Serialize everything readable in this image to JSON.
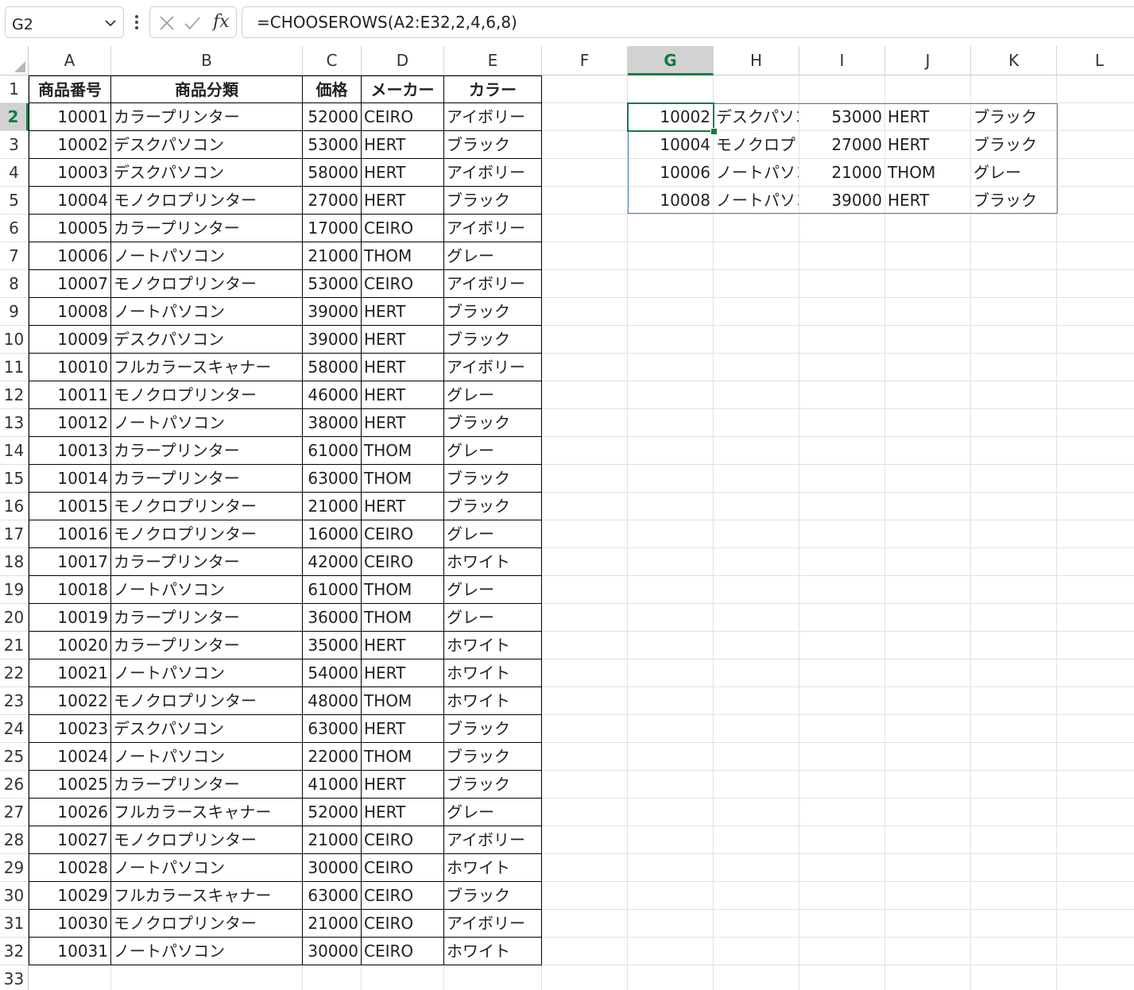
{
  "name_box": {
    "value": "G2"
  },
  "formula_bar": {
    "cancel_icon": "close-icon",
    "enter_icon": "check-icon",
    "function_label": "fx",
    "formula": "=CHOOSEROWS(A2:E32,2,4,6,8)"
  },
  "selected_cell": "G2",
  "columns": [
    "A",
    "B",
    "C",
    "D",
    "E",
    "F",
    "G",
    "H",
    "I",
    "J",
    "K",
    "L"
  ],
  "rows": [
    "1",
    "2",
    "3",
    "4",
    "5",
    "6",
    "7",
    "8",
    "9",
    "10",
    "11",
    "12",
    "13",
    "14",
    "15",
    "16",
    "17",
    "18",
    "19",
    "20",
    "21",
    "22",
    "23",
    "24",
    "25",
    "26",
    "27",
    "28",
    "29",
    "30",
    "31",
    "32",
    "33"
  ],
  "table": {
    "headers": [
      "商品番号",
      "商品分類",
      "価格",
      "メーカー",
      "カラー"
    ],
    "rows": [
      [
        "10001",
        "カラープリンター",
        "52000",
        "CEIRO",
        "アイボリー"
      ],
      [
        "10002",
        "デスクパソコン",
        "53000",
        "HERT",
        "ブラック"
      ],
      [
        "10003",
        "デスクパソコン",
        "58000",
        "HERT",
        "アイボリー"
      ],
      [
        "10004",
        "モノクロプリンター",
        "27000",
        "HERT",
        "ブラック"
      ],
      [
        "10005",
        "カラープリンター",
        "17000",
        "CEIRO",
        "アイボリー"
      ],
      [
        "10006",
        "ノートパソコン",
        "21000",
        "THOM",
        "グレー"
      ],
      [
        "10007",
        "モノクロプリンター",
        "53000",
        "CEIRO",
        "アイボリー"
      ],
      [
        "10008",
        "ノートパソコン",
        "39000",
        "HERT",
        "ブラック"
      ],
      [
        "10009",
        "デスクパソコン",
        "39000",
        "HERT",
        "ブラック"
      ],
      [
        "10010",
        "フルカラースキャナー",
        "58000",
        "HERT",
        "アイボリー"
      ],
      [
        "10011",
        "モノクロプリンター",
        "46000",
        "HERT",
        "グレー"
      ],
      [
        "10012",
        "ノートパソコン",
        "38000",
        "HERT",
        "ブラック"
      ],
      [
        "10013",
        "カラープリンター",
        "61000",
        "THOM",
        "グレー"
      ],
      [
        "10014",
        "カラープリンター",
        "63000",
        "THOM",
        "ブラック"
      ],
      [
        "10015",
        "モノクロプリンター",
        "21000",
        "HERT",
        "ブラック"
      ],
      [
        "10016",
        "モノクロプリンター",
        "16000",
        "CEIRO",
        "グレー"
      ],
      [
        "10017",
        "カラープリンター",
        "42000",
        "CEIRO",
        "ホワイト"
      ],
      [
        "10018",
        "ノートパソコン",
        "61000",
        "THOM",
        "グレー"
      ],
      [
        "10019",
        "カラープリンター",
        "36000",
        "THOM",
        "グレー"
      ],
      [
        "10020",
        "カラープリンター",
        "35000",
        "HERT",
        "ホワイト"
      ],
      [
        "10021",
        "ノートパソコン",
        "54000",
        "HERT",
        "ホワイト"
      ],
      [
        "10022",
        "モノクロプリンター",
        "48000",
        "THOM",
        "ホワイト"
      ],
      [
        "10023",
        "デスクパソコン",
        "63000",
        "HERT",
        "ブラック"
      ],
      [
        "10024",
        "ノートパソコン",
        "22000",
        "THOM",
        "ブラック"
      ],
      [
        "10025",
        "カラープリンター",
        "41000",
        "HERT",
        "ブラック"
      ],
      [
        "10026",
        "フルカラースキャナー",
        "52000",
        "HERT",
        "グレー"
      ],
      [
        "10027",
        "モノクロプリンター",
        "21000",
        "CEIRO",
        "アイボリー"
      ],
      [
        "10028",
        "ノートパソコン",
        "30000",
        "CEIRO",
        "ホワイト"
      ],
      [
        "10029",
        "フルカラースキャナー",
        "63000",
        "CEIRO",
        "ブラック"
      ],
      [
        "10030",
        "モノクロプリンター",
        "21000",
        "CEIRO",
        "アイボリー"
      ],
      [
        "10031",
        "ノートパソコン",
        "30000",
        "CEIRO",
        "ホワイト"
      ]
    ]
  },
  "spill_result": {
    "rows": [
      [
        "10002",
        "デスクパソコン",
        "53000",
        "HERT",
        "ブラック"
      ],
      [
        "10004",
        "モノクロプリンター",
        "27000",
        "HERT",
        "ブラック"
      ],
      [
        "10006",
        "ノートパソコン",
        "21000",
        "THOM",
        "グレー"
      ],
      [
        "10008",
        "ノートパソコン",
        "39000",
        "HERT",
        "ブラック"
      ]
    ]
  },
  "colors": {
    "selection_accent": "#107c41",
    "spill_border": "#4a7ebb",
    "gridline": "#e1e1e1",
    "table_border": "#000000"
  }
}
